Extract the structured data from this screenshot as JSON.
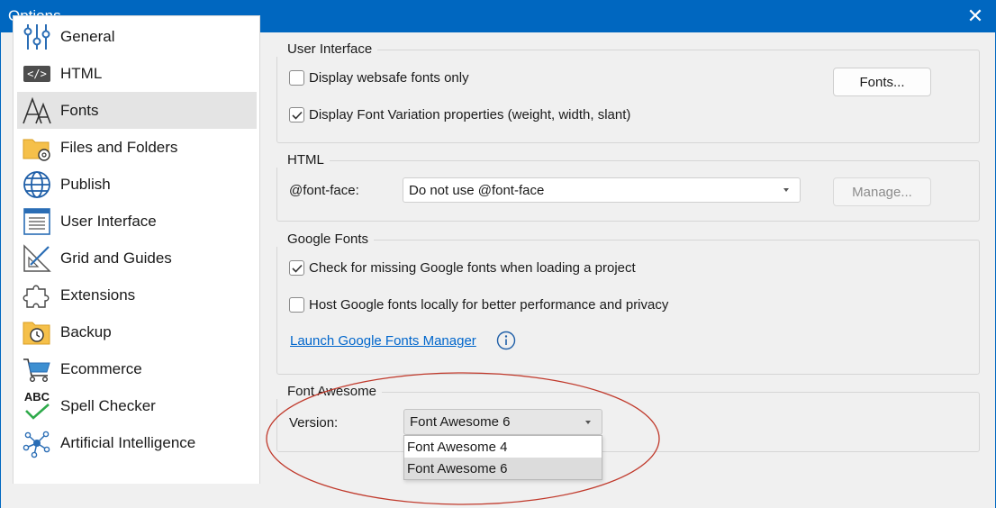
{
  "window": {
    "title": "Options",
    "close_glyph": "✕"
  },
  "sidebar": {
    "selected": "Fonts",
    "items": [
      {
        "label": "General",
        "icon": "sliders-icon"
      },
      {
        "label": "HTML",
        "icon": "code-tag-icon",
        "icon_text": "</>"
      },
      {
        "label": "Fonts",
        "icon": "font-glyph-icon"
      },
      {
        "label": "Files and Folders",
        "icon": "folder-gear-icon"
      },
      {
        "label": "Publish",
        "icon": "globe-icon"
      },
      {
        "label": "User Interface",
        "icon": "window-layout-icon"
      },
      {
        "label": "Grid and Guides",
        "icon": "ruler-triangle-icon"
      },
      {
        "label": "Extensions",
        "icon": "puzzle-piece-icon"
      },
      {
        "label": "Backup",
        "icon": "backup-clock-icon"
      },
      {
        "label": "Ecommerce",
        "icon": "shopping-cart-icon"
      },
      {
        "label": "Spell Checker",
        "icon": "abc-check-icon",
        "icon_text": "ABC"
      },
      {
        "label": "Artificial Intelligence",
        "icon": "ai-network-icon"
      }
    ]
  },
  "user_interface": {
    "title": "User Interface",
    "websafe_label": "Display websafe fonts only",
    "websafe_checked": false,
    "variation_label": "Display Font Variation properties (weight, width, slant)",
    "variation_checked": true,
    "fonts_button": "Fonts..."
  },
  "html_group": {
    "title": "HTML",
    "fontface_label": "@font-face:",
    "fontface_value": "Do not use @font-face",
    "manage_button": "Manage..."
  },
  "google_fonts": {
    "title": "Google Fonts",
    "check_missing_label": "Check for missing Google fonts when loading a project",
    "check_missing_checked": true,
    "host_locally_label": "Host Google fonts locally for better performance and privacy",
    "host_locally_checked": false,
    "launch_link": "Launch Google Fonts Manager"
  },
  "font_awesome": {
    "title": "Font Awesome",
    "version_label": "Version:",
    "selected": "Font Awesome 6",
    "options": [
      "Font Awesome 4",
      "Font Awesome 6"
    ]
  },
  "colors": {
    "titlebar": "#0067c0",
    "link": "#0066cc",
    "annotation": "#c0392b"
  }
}
